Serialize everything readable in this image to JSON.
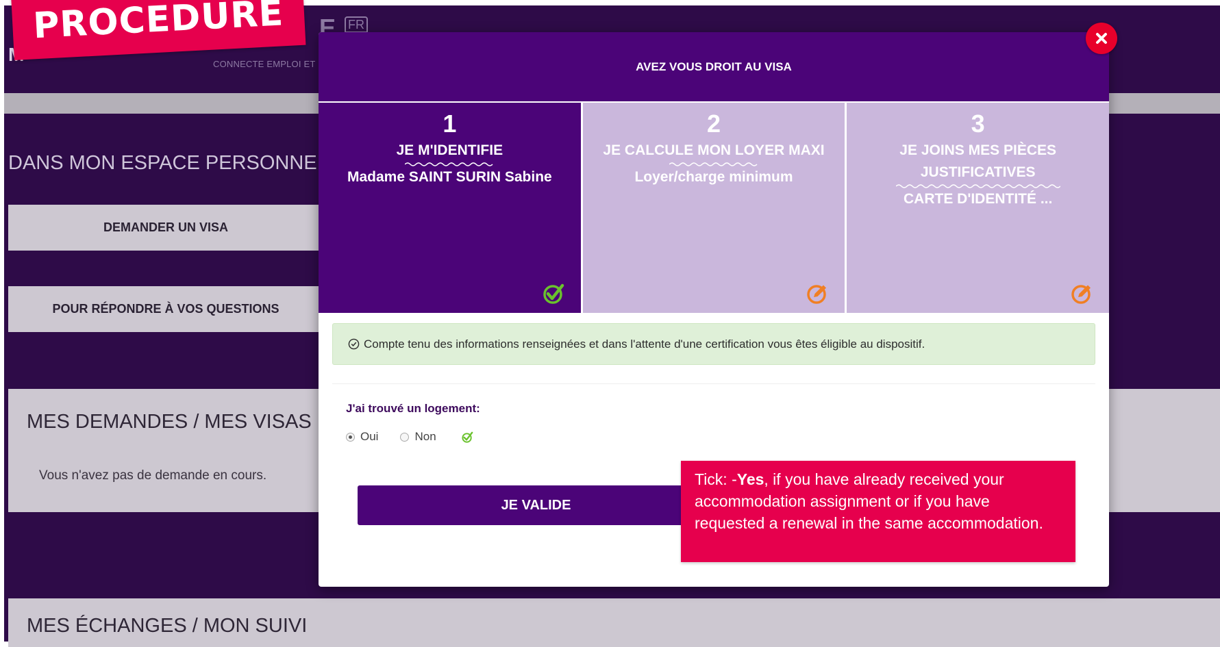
{
  "background": {
    "logo_icon": "FR",
    "tagline": "CONNECTE EMPLOI ET",
    "logo_partial": "M",
    "section_title": "DANS MON ESPACE PERSONNEL",
    "buttons": {
      "visa": "DEMANDER UN VISA",
      "questions": "POUR RÉPONDRE À VOS QUESTIONS"
    },
    "demandes": {
      "title": "MES DEMANDES / MES VISAS",
      "text": "Vous n'avez pas de demande en cours."
    },
    "echanges": {
      "title": "MES ÉCHANGES / MON SUIVI"
    }
  },
  "banner": {
    "label": "PROCEDURE"
  },
  "modal": {
    "title": "AVEZ VOUS DROIT AU VISA",
    "steps": [
      {
        "number": "1",
        "title": "JE M'IDENTIFIE",
        "value": "Madame SAINT SURIN Sabine",
        "status_icon": "check-icon"
      },
      {
        "number": "2",
        "title": "JE CALCULE MON LOYER MAXI",
        "value": "Loyer/charge minimum",
        "status_icon": "edit-icon"
      },
      {
        "number": "3",
        "title": "JE JOINS MES PIÈCES JUSTIFICATIVES",
        "value": "CARTE D'IDENTITÉ ...",
        "status_icon": "edit-icon"
      }
    ],
    "alert": "Compte tenu des informations renseignées et dans l'attente d'une certification vous êtes éligible au dispositif.",
    "question": {
      "label": "J'ai trouvé un logement:",
      "options": [
        "Oui",
        "Non"
      ],
      "selected": "Oui"
    },
    "validate_label": "JE VALIDE"
  },
  "callout": {
    "prefix": "Tick: -",
    "strong": "Yes",
    "text": ", if you have already received your accommodation assignment or if you have requested a renewal in the same accommodation."
  },
  "colors": {
    "primary": "#4b0478",
    "step_inactive": "#cab7dc",
    "success": "#6ac22d",
    "warning": "#f07f24",
    "alert_bg": "#dff0d8",
    "callout_bg": "#e6004d",
    "close_bg": "#e8002b"
  }
}
